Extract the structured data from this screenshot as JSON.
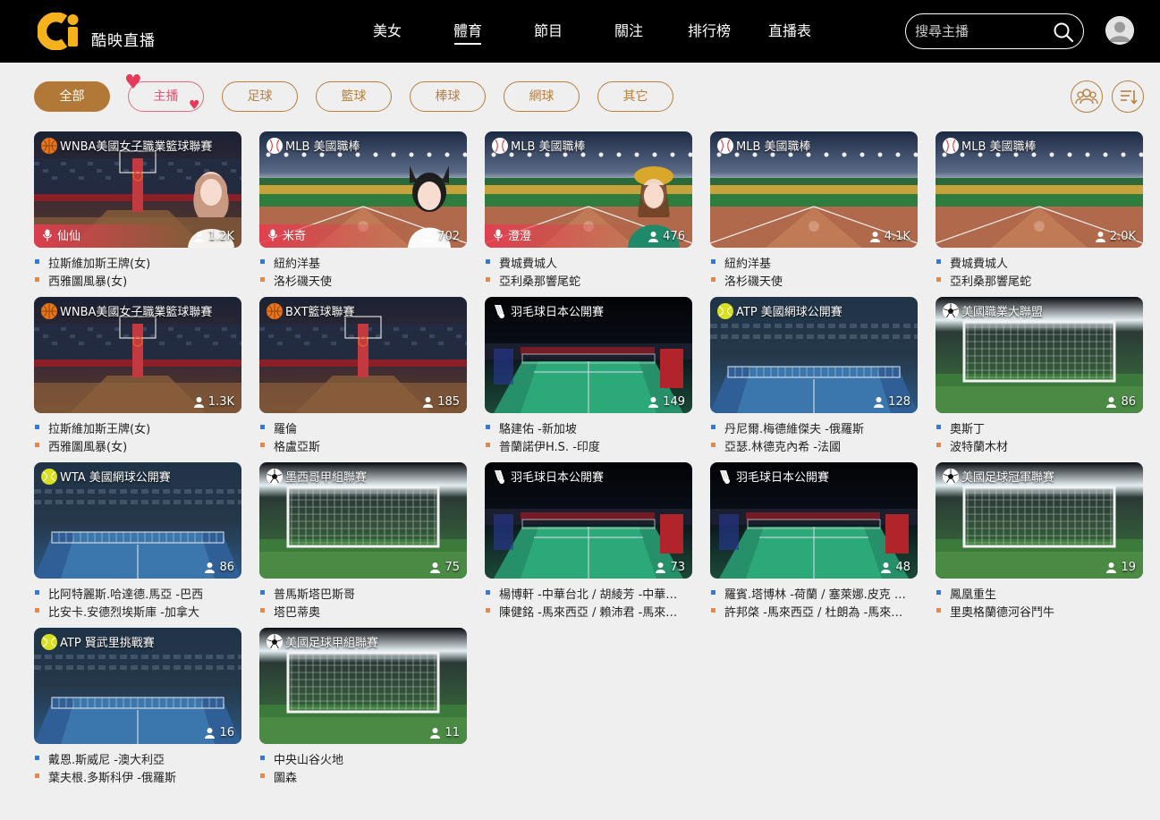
{
  "brand": {
    "name": "酷映直播"
  },
  "nav": [
    {
      "label": "美女"
    },
    {
      "label": "體育"
    },
    {
      "label": "節目"
    },
    {
      "label": "關注"
    },
    {
      "label": "排行榜"
    },
    {
      "label": "直播表"
    }
  ],
  "search": {
    "placeholder": "搜尋主播"
  },
  "filters": [
    {
      "label": "全部"
    },
    {
      "label": "主播"
    },
    {
      "label": "足球"
    },
    {
      "label": "籃球"
    },
    {
      "label": "棒球"
    },
    {
      "label": "網球"
    },
    {
      "label": "其它"
    }
  ],
  "cards": [
    {
      "league": "WNBA美國女子職業籃球聯賽",
      "sport": "basketball",
      "viewers": "1.2K",
      "host": "仙仙",
      "home": "拉斯維加斯王牌(女)",
      "away": "西雅圖風暴(女)"
    },
    {
      "league": "MLB 美國職棒",
      "sport": "baseball",
      "viewers": "702",
      "host": "米奇",
      "home": "紐約洋基",
      "away": "洛杉磯天使"
    },
    {
      "league": "MLB 美國職棒",
      "sport": "baseball",
      "viewers": "476",
      "host": "澄澄",
      "home": "費城費城人",
      "away": "亞利桑那響尾蛇"
    },
    {
      "league": "MLB 美國職棒",
      "sport": "baseball",
      "viewers": "4.1K",
      "host": "",
      "home": "紐約洋基",
      "away": "洛杉磯天使"
    },
    {
      "league": "MLB 美國職棒",
      "sport": "baseball",
      "viewers": "2.0K",
      "host": "",
      "home": "費城費城人",
      "away": "亞利桑那響尾蛇"
    },
    {
      "league": "WNBA美國女子職業籃球聯賽",
      "sport": "basketball",
      "viewers": "1.3K",
      "host": "",
      "home": "拉斯維加斯王牌(女)",
      "away": "西雅圖風暴(女)"
    },
    {
      "league": "BXT籃球聯賽",
      "sport": "basketball",
      "viewers": "185",
      "host": "",
      "home": "羅倫",
      "away": "格盧亞斯"
    },
    {
      "league": "羽毛球日本公開賽",
      "sport": "badminton",
      "viewers": "149",
      "host": "",
      "home": "駱建佑 -新加坡",
      "away": "普蘭諾伊H.S. -印度"
    },
    {
      "league": "ATP 美國網球公開賽",
      "sport": "tennis",
      "viewers": "128",
      "host": "",
      "home": "丹尼爾.梅德維傑夫 -俄羅斯",
      "away": "亞瑟.林德克內希 -法國"
    },
    {
      "league": "美國職業大聯盟",
      "sport": "soccer",
      "viewers": "86",
      "host": "",
      "home": "奧斯丁",
      "away": "波特蘭木材"
    },
    {
      "league": "WTA 美國網球公開賽",
      "sport": "tennis",
      "viewers": "86",
      "host": "",
      "home": "比阿特麗斯.哈達德.馬亞 -巴西",
      "away": "比安卡.安德烈埃斯庫 -加拿大"
    },
    {
      "league": "墨西哥甲組聯賽",
      "sport": "soccer",
      "viewers": "75",
      "host": "",
      "home": "普馬斯塔巴斯哥",
      "away": "塔巴蒂奧"
    },
    {
      "league": "羽毛球日本公開賽",
      "sport": "badminton",
      "viewers": "73",
      "host": "",
      "home": "楊博軒 -中華台北 / 胡綾芳 -中華…",
      "away": "陳健銘 -馬來西亞 / 賴沛君 -馬來…"
    },
    {
      "league": "羽毛球日本公開賽",
      "sport": "badminton",
      "viewers": "48",
      "host": "",
      "home": "羅賓.塔博林 -荷蘭 / 塞萊娜.皮克 …",
      "away": "許邦棨 -馬來西亞 / 杜朗為 -馬來…"
    },
    {
      "league": "美國足球冠軍聯賽",
      "sport": "soccer",
      "viewers": "19",
      "host": "",
      "home": "鳳凰重生",
      "away": "里奧格蘭德河谷鬥牛"
    },
    {
      "league": "ATP 賢武里挑戰賽",
      "sport": "tennis",
      "viewers": "16",
      "host": "",
      "home": "戴恩.斯威尼 -澳大利亞",
      "away": "葉夫根.多斯科伊 -俄羅斯"
    },
    {
      "league": "美國足球甲組聯賽",
      "sport": "soccer",
      "viewers": "11",
      "host": "",
      "home": "中央山谷火地",
      "away": "圖森"
    }
  ]
}
